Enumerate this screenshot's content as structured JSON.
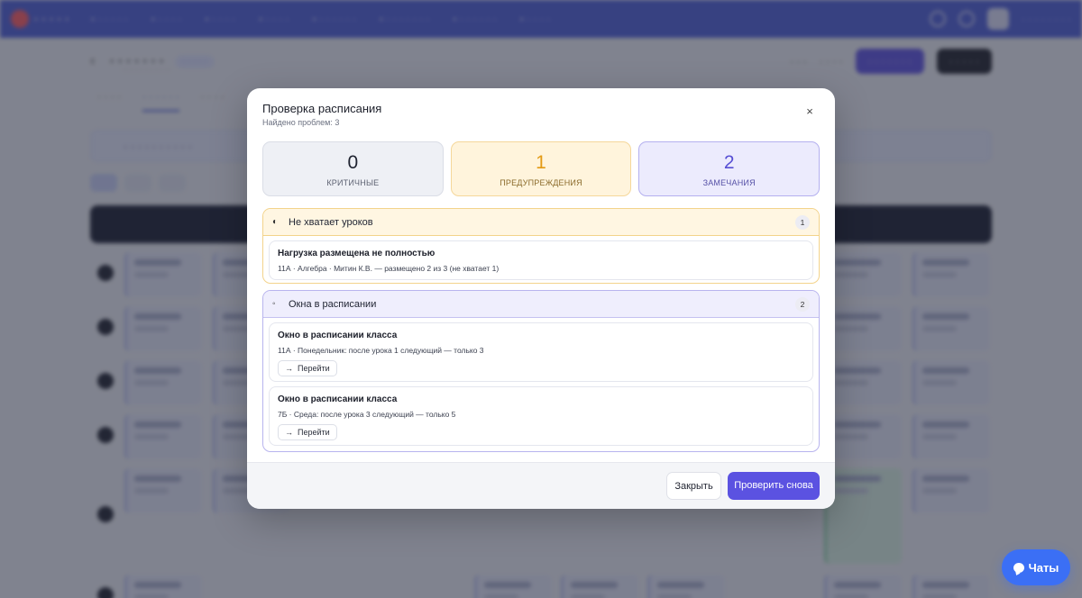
{
  "modal": {
    "title": "Проверка расписания",
    "subtitle": "Найдено проблем: 3",
    "close_icon": "×",
    "stats": [
      {
        "count": "0",
        "label": "КРИТИЧНЫЕ"
      },
      {
        "count": "1",
        "label": "ПРЕДУПРЕЖДЕНИЯ"
      },
      {
        "count": "2",
        "label": "ЗАМЕЧАНИЯ"
      }
    ],
    "groups": [
      {
        "icon": "◐",
        "title": "Не хватает уроков",
        "count": "1",
        "issues": [
          {
            "title": "Нагрузка размещена не полностью",
            "detail": "11А · Алгебра · Митин К.В. — размещено 2 из 3 (не хватает 1)"
          }
        ]
      },
      {
        "icon": "◦",
        "title": "Окна в расписании",
        "count": "2",
        "issues": [
          {
            "title": "Окно в расписании класса",
            "detail": "11А · Понедельник: после урока 1 следующий — только 3",
            "action": "Перейти"
          },
          {
            "title": "Окно в расписании класса",
            "detail": "7Б · Среда: после урока 3 следующий — только 5",
            "action": "Перейти"
          }
        ]
      }
    ],
    "footer": {
      "close_label": "Закрыть",
      "recheck_label": "Проверить снова"
    }
  },
  "chat": {
    "label": "Чаты"
  },
  "colors": {
    "accent": "#5b52e1",
    "warning": "#e39a14",
    "note": "#574fd4",
    "chat": "#3b6ff5"
  }
}
